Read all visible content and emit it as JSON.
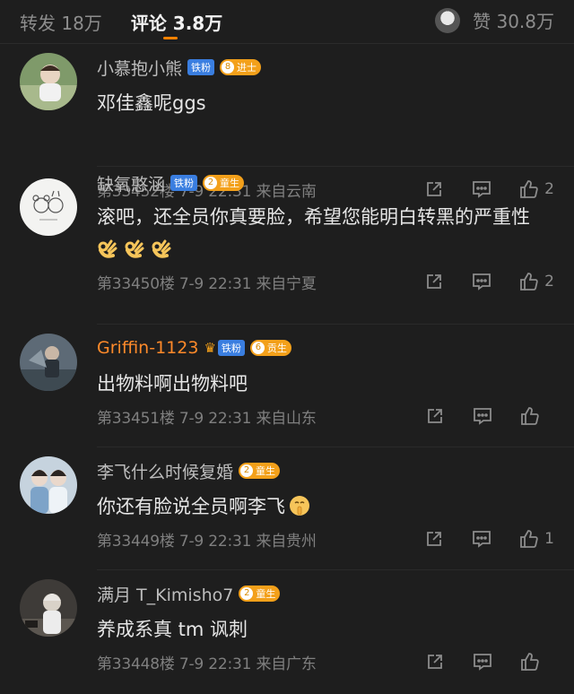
{
  "tabs": {
    "repost": "转发 18万",
    "comments": "评论 3.8万",
    "likes": "赞 30.8万"
  },
  "colors": {
    "accent": "#ff8200",
    "background": "#1e1e1e"
  },
  "comments": [
    {
      "name": "小慕抱小熊",
      "fan_badge": "铁粉",
      "level_num": "8",
      "level_label": "进士",
      "text": "邓佳鑫呢ggs",
      "meta": "第33452楼 7-9 22:31 来自云南",
      "like_count": "2"
    },
    {
      "name": "缺氧憨涵",
      "fan_badge": "铁粉",
      "level_num": "2",
      "level_label": "童生",
      "text": "滚吧，还全员你真要脸，希望您能明白转黑的严重性",
      "meta": "第33450楼 7-9 22:31 来自宁夏",
      "like_count": "2"
    },
    {
      "name": "Griffin-1123",
      "fan_badge": "铁粉",
      "level_num": "6",
      "level_label": "贡生",
      "text": "出物料啊出物料吧",
      "meta": "第33451楼 7-9 22:31 来自山东",
      "like_count": ""
    },
    {
      "name": "李飞什么时候复婚",
      "level_num": "2",
      "level_label": "童生",
      "text": "你还有脸说全员啊李飞",
      "meta": "第33449楼 7-9 22:31 来自贵州",
      "like_count": "1"
    },
    {
      "name": "满月 T_Kimisho7",
      "level_num": "2",
      "level_label": "童生",
      "text": "养成系真 tm 讽刺",
      "meta": "第33448楼 7-9 22:31 来自广东",
      "like_count": ""
    }
  ],
  "icons": [
    "share-icon",
    "comment-icon",
    "like-icon",
    "ok-hand-emoji",
    "shush-face-emoji",
    "crown-icon"
  ]
}
